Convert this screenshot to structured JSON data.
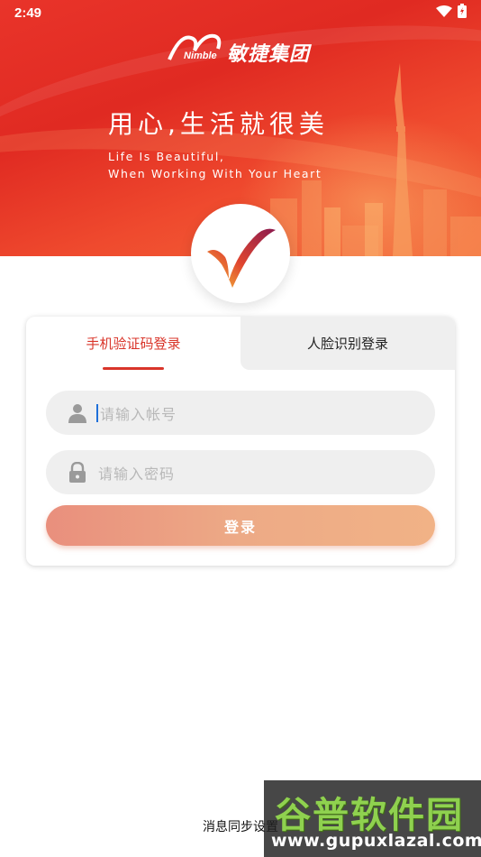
{
  "status_bar": {
    "time": "2:49",
    "wifi_icon": "wifi-icon",
    "battery_icon": "battery-icon"
  },
  "banner": {
    "brand_en": "Nimble",
    "brand_cn": "敏捷集团",
    "slogan_cn": "用心,生活就很美",
    "slogan_en_line1": "Life Is Beautiful,",
    "slogan_en_line2": "When Working With Your Heart"
  },
  "login": {
    "tabs": [
      {
        "label": "手机验证码登录",
        "active": true
      },
      {
        "label": "人脸识别登录",
        "active": false
      }
    ],
    "account_placeholder": "请输入帐号",
    "password_placeholder": "请输入密码",
    "login_label": "登录"
  },
  "footer": {
    "sync_settings": "消息同步设置"
  },
  "watermark": {
    "cn": "谷普软件园",
    "url": "www.gupuxlazal.com"
  },
  "colors": {
    "accent": "#d9352a",
    "banner": "#e02a22",
    "button_start": "#e98f7d",
    "button_end": "#f1b286"
  }
}
